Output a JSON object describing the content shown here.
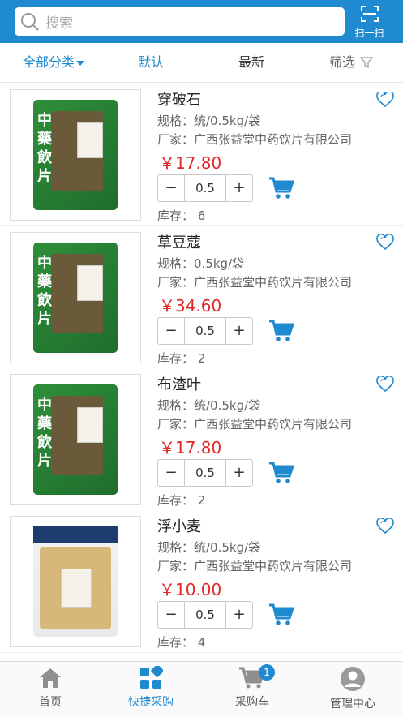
{
  "header": {
    "search_placeholder": "搜索",
    "scan_label": "扫一扫"
  },
  "filter_bar": {
    "all_categories": "全部分类",
    "default": "默认",
    "newest": "最新",
    "filter": "筛选"
  },
  "products": [
    {
      "name": "穿破石",
      "spec": "规格：统/0.5kg/袋",
      "maker": "厂家：广西张益堂中药饮片有限公司",
      "price": "￥17.80",
      "qty": "0.5",
      "stock": "库存：  6",
      "package": "green"
    },
    {
      "name": "草豆蔻",
      "spec": "规格：0.5kg/袋",
      "maker": "厂家：广西张益堂中药饮片有限公司",
      "price": "￥34.60",
      "qty": "0.5",
      "stock": "库存：  2",
      "package": "green"
    },
    {
      "name": "布渣叶",
      "spec": "规格：统/0.5kg/袋",
      "maker": "厂家：广西张益堂中药饮片有限公司",
      "price": "￥17.80",
      "qty": "0.5",
      "stock": "库存：  2",
      "package": "green"
    },
    {
      "name": "浮小麦",
      "spec": "规格：统/0.5kg/袋",
      "maker": "厂家：广西张益堂中药饮片有限公司",
      "price": "￥10.00",
      "qty": "0.5",
      "stock": "库存：  4",
      "package": "white"
    }
  ],
  "stepper": {
    "minus": "−",
    "plus": "+"
  },
  "package_text": "中藥飲片",
  "tabbar": {
    "tabs": [
      {
        "label": "首页",
        "icon": "home-icon"
      },
      {
        "label": "快捷采购",
        "icon": "grid-icon"
      },
      {
        "label": "采购车",
        "icon": "cart-icon"
      },
      {
        "label": "管理中心",
        "icon": "user-icon"
      }
    ],
    "cart_badge": "1",
    "active_tab": "快捷采购"
  },
  "colors": {
    "accent": "#1f8ad0",
    "price": "#e02a2a",
    "package_green": "#2e8f3a"
  }
}
